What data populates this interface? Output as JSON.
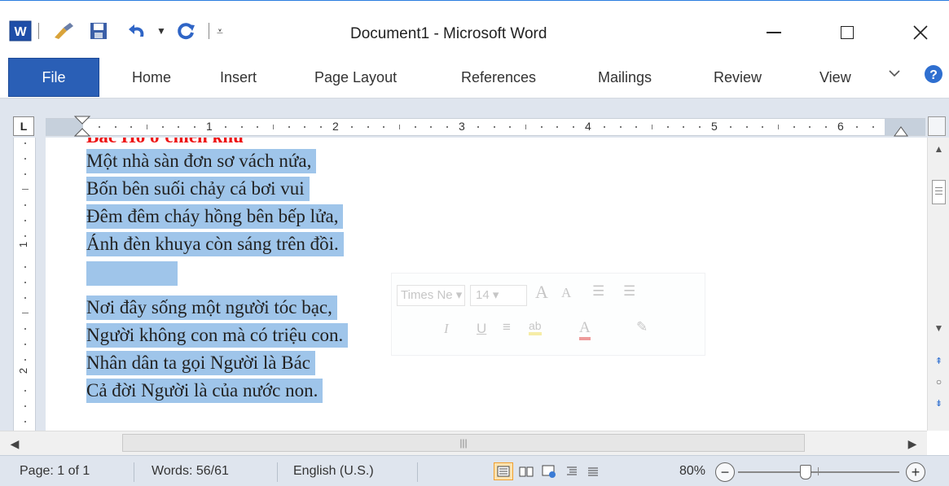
{
  "window": {
    "title": "Document1 - Microsoft Word",
    "minimize_label": "—",
    "maximize_label": "☐",
    "close_label": "✕"
  },
  "ribbon": {
    "tabs": [
      "File",
      "Home",
      "Insert",
      "Page Layout",
      "References",
      "Mailings",
      "Review",
      "View"
    ],
    "help_label": "?",
    "collapse_label": "♡"
  },
  "ruler": {
    "tab_selector": "L",
    "numbers": [
      "1",
      "2",
      "3",
      "4",
      "5",
      "6"
    ],
    "vnumbers": [
      "1",
      "2"
    ]
  },
  "document": {
    "heading": "Bác Hồ ở chiến khu",
    "stanza1": [
      "Một nhà sàn đơn sơ vách nứa,",
      "Bốn bên suối chảy cá bơi vui",
      "Đêm đêm cháy hồng bên bếp lửa,",
      "Ánh đèn khuya còn sáng trên đồi."
    ],
    "stanza2": [
      "Nơi đây sống một người tóc bạc,",
      "Người không con mà có triệu con.",
      "Nhân dân ta gọi Người là Bác",
      "Cả đời Người là của nước non."
    ],
    "selection_color": "#9fc5ea",
    "heading_color": "#ee1111"
  },
  "mini_toolbar": {
    "font_name": "Times Ne",
    "font_size": "14",
    "grow_font": "A",
    "shrink_font": "A",
    "italic": "I",
    "underline": "U",
    "highlight": "ab",
    "font_color": "A"
  },
  "statusbar": {
    "page": "Page: 1 of 1",
    "words": "Words: 56/61",
    "language": "English (U.S.)",
    "zoom": "80%",
    "zoom_out": "−",
    "zoom_in": "+",
    "zoom_percent": 80
  },
  "colors": {
    "file_tab": "#2a5fb6",
    "ruler_bg": "#dfe5ee"
  }
}
